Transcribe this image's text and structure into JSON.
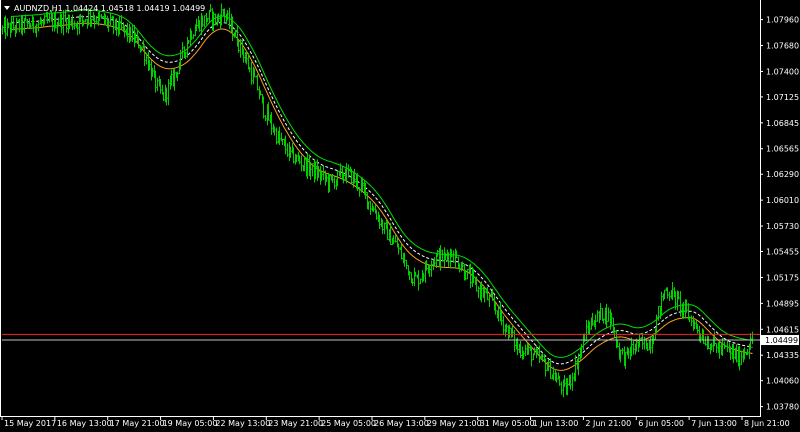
{
  "window": {
    "symbol_line": "AUDNZD,H1  1.04424 1.04518 1.04419 1.04499"
  },
  "chart_data": {
    "type": "candlestick",
    "symbol": "AUDNZD",
    "timeframe": "H1",
    "ohlc_header": {
      "open": 1.04424,
      "high": 1.04518,
      "low": 1.04419,
      "close": 1.04499
    },
    "y_ticks": [
      1.0796,
      1.0768,
      1.074,
      1.07125,
      1.06845,
      1.06565,
      1.0629,
      1.0601,
      1.0573,
      1.05455,
      1.05175,
      1.04895,
      1.04615,
      1.04335,
      1.0406,
      1.0378
    ],
    "y_tick_labels": [
      "1.07960",
      "1.07680",
      "1.07400",
      "1.07125",
      "1.06845",
      "1.06565",
      "1.06290",
      "1.06010",
      "1.05730",
      "1.05455",
      "1.05175",
      "1.04895",
      "1.04615",
      "1.04335",
      "1.04060",
      "1.03780"
    ],
    "ylim": [
      1.037,
      1.0815
    ],
    "x_labels": [
      "15 May 2017",
      "16 May 13:00",
      "17 May 21:00",
      "19 May 05:00",
      "22 May 13:00",
      "23 May 21:00",
      "25 May 05:00",
      "26 May 13:00",
      "29 May 21:00",
      "31 May 05:00",
      "1 Jun 13:00",
      "2 Jun 21:00",
      "6 Jun 05:00",
      "7 Jun 13:00",
      "8 Jun 21:00"
    ],
    "current_price": 1.04499,
    "current_price_label": "1.04499",
    "ask_line": 1.0456,
    "price_path": [
      [
        0,
        1.0785
      ],
      [
        3,
        1.079
      ],
      [
        6,
        1.0792
      ],
      [
        9,
        1.0795
      ],
      [
        11,
        1.0792
      ],
      [
        13,
        1.08
      ],
      [
        15,
        1.0795
      ],
      [
        17,
        1.0788
      ],
      [
        19,
        1.078
      ],
      [
        21,
        1.0765
      ],
      [
        22,
        1.0745
      ],
      [
        23,
        1.0725
      ],
      [
        24,
        1.0712
      ],
      [
        25,
        1.0725
      ],
      [
        26,
        1.074
      ],
      [
        27,
        1.076
      ],
      [
        28,
        1.078
      ],
      [
        29,
        1.079
      ],
      [
        30,
        1.0795
      ],
      [
        31,
        1.08
      ],
      [
        32,
        1.0795
      ],
      [
        33,
        1.0805
      ],
      [
        34,
        1.079
      ],
      [
        35,
        1.0775
      ],
      [
        36,
        1.076
      ],
      [
        37,
        1.074
      ],
      [
        38,
        1.0725
      ],
      [
        39,
        1.07
      ],
      [
        40,
        1.0685
      ],
      [
        41,
        1.067
      ],
      [
        42,
        1.066
      ],
      [
        43,
        1.065
      ],
      [
        44,
        1.0645
      ],
      [
        45,
        1.064
      ],
      [
        46,
        1.0635
      ],
      [
        47,
        1.063
      ],
      [
        48,
        1.0625
      ],
      [
        49,
        1.062
      ],
      [
        50,
        1.0625
      ],
      [
        51,
        1.063
      ],
      [
        52,
        1.0628
      ],
      [
        53,
        1.062
      ],
      [
        54,
        1.061
      ],
      [
        55,
        1.0595
      ],
      [
        56,
        1.0585
      ],
      [
        57,
        1.057
      ],
      [
        58,
        1.056
      ],
      [
        59,
        1.055
      ],
      [
        60,
        1.0535
      ],
      [
        61,
        1.052
      ],
      [
        62,
        1.0515
      ],
      [
        63,
        1.0525
      ],
      [
        64,
        1.0535
      ],
      [
        65,
        1.054
      ],
      [
        66,
        1.0538
      ],
      [
        67,
        1.0545
      ],
      [
        68,
        1.0535
      ],
      [
        69,
        1.0525
      ],
      [
        70,
        1.0515
      ],
      [
        71,
        1.0505
      ],
      [
        72,
        1.05
      ],
      [
        73,
        1.049
      ],
      [
        74,
        1.048
      ],
      [
        75,
        1.0465
      ],
      [
        76,
        1.0455
      ],
      [
        77,
        1.044
      ],
      [
        78,
        1.044
      ],
      [
        79,
        1.0435
      ],
      [
        80,
        1.043
      ],
      [
        81,
        1.0425
      ],
      [
        82,
        1.0415
      ],
      [
        83,
        1.0405
      ],
      [
        84,
        1.0395
      ],
      [
        85,
        1.041
      ],
      [
        86,
        1.043
      ],
      [
        87,
        1.0455
      ],
      [
        88,
        1.047
      ],
      [
        89,
        1.0475
      ],
      [
        90,
        1.048
      ],
      [
        91,
        1.047
      ],
      [
        92,
        1.044
      ],
      [
        93,
        1.043
      ],
      [
        94,
        1.044
      ],
      [
        95,
        1.0445
      ],
      [
        96,
        1.0445
      ],
      [
        97,
        1.045
      ],
      [
        98,
        1.048
      ],
      [
        99,
        1.0505
      ],
      [
        100,
        1.05
      ],
      [
        101,
        1.049
      ],
      [
        102,
        1.048
      ],
      [
        103,
        1.047
      ],
      [
        104,
        1.046
      ],
      [
        105,
        1.045
      ],
      [
        106,
        1.0445
      ],
      [
        107,
        1.044
      ],
      [
        108,
        1.044
      ],
      [
        109,
        1.0435
      ],
      [
        110,
        1.043
      ],
      [
        111,
        1.044
      ],
      [
        112,
        1.0448
      ]
    ]
  }
}
